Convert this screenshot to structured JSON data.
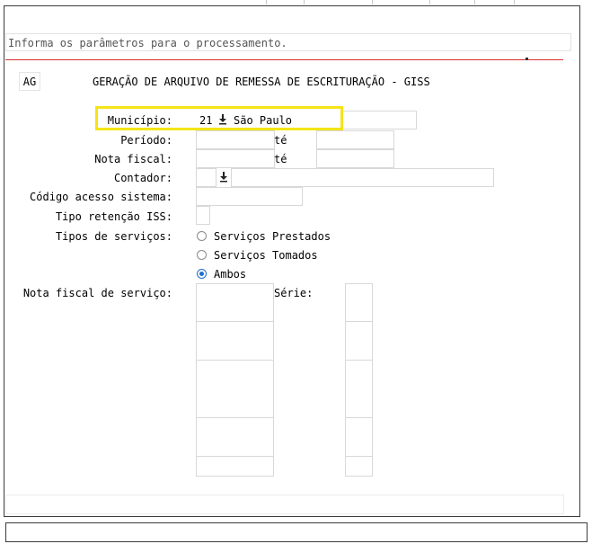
{
  "message": {
    "text": "Informa os parâmetros para o processamento."
  },
  "header": {
    "code": "AG",
    "title": "GERAÇÃO DE ARQUIVO DE REMESSA DE ESCRITURAÇÃO - GISS"
  },
  "form": {
    "municipio": {
      "label": "Município:",
      "code": "21",
      "name": "São Paulo"
    },
    "periodo": {
      "label": "Período:",
      "ate": "té",
      "from": "",
      "to": ""
    },
    "nota_fiscal": {
      "label": "Nota fiscal:",
      "ate": "té",
      "from": "",
      "to": ""
    },
    "contador": {
      "label": "Contador:",
      "code": "",
      "name": ""
    },
    "codigo_acesso": {
      "label": "Código acesso sistema:",
      "value": ""
    },
    "tipo_retencao": {
      "label": "Tipo retenção ISS:",
      "value": ""
    },
    "tipos_servicos": {
      "label": "Tipos de serviços:",
      "options": [
        {
          "label": "Serviços Prestados",
          "selected": false
        },
        {
          "label": "Serviços Tomados",
          "selected": false
        },
        {
          "label": "Ambos",
          "selected": true
        }
      ]
    },
    "nf_servico": {
      "label": "Nota fiscal de serviço:",
      "serie_label": "Série:",
      "rows": [
        "",
        "",
        "",
        "",
        "",
        "",
        "",
        "",
        "",
        ""
      ]
    }
  },
  "colors": {
    "highlight": "#f4e418",
    "accent": "#1e6fd0",
    "divider": "#d83030"
  },
  "icons": {
    "lookup": "download-arrow-icon"
  }
}
